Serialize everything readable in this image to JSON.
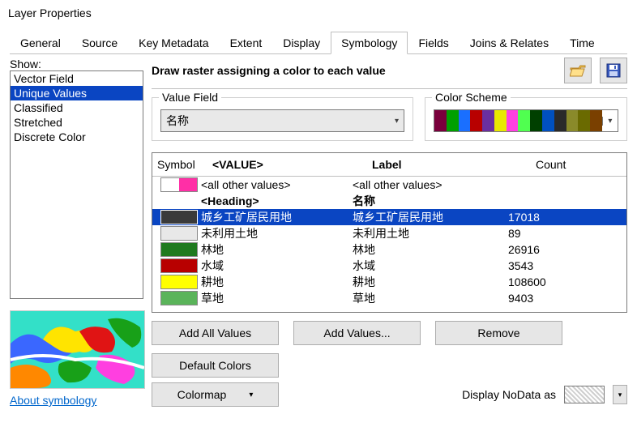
{
  "window": {
    "title": "Layer Properties"
  },
  "tabs": [
    "General",
    "Source",
    "Key Metadata",
    "Extent",
    "Display",
    "Symbology",
    "Fields",
    "Joins & Relates",
    "Time"
  ],
  "left": {
    "show_label": "Show:",
    "items": [
      "Vector Field",
      "Unique Values",
      "Classified",
      "Stretched",
      "Discrete Color"
    ],
    "selected_index": 1,
    "about": "About symbology"
  },
  "right": {
    "draw_label": "Draw raster assigning a color to each value",
    "value_field": {
      "legend": "Value Field",
      "selected": "名称"
    },
    "color_scheme": {
      "legend": "Color Scheme",
      "swatches": [
        "#7a003c",
        "#00a000",
        "#1a6fff",
        "#b80000",
        "#6a2fa0",
        "#e8e800",
        "#ff40e0",
        "#50ff50",
        "#004000",
        "#0050c0",
        "#2a2a2a",
        "#8a8a2a",
        "#6a6a00",
        "#7a4000"
      ]
    },
    "grid": {
      "headers": {
        "symbol": "Symbol",
        "value": "<VALUE>",
        "label": "Label",
        "count": "Count"
      },
      "all_other": {
        "value": "<all other values>",
        "label": "<all other values>",
        "color": "#ff2fa6"
      },
      "heading": {
        "value": "<Heading>",
        "label": "名称"
      },
      "rows": [
        {
          "color": "#3a3a3a",
          "value": "城乡工矿居民用地",
          "label": "城乡工矿居民用地",
          "count": "17018",
          "selected": true
        },
        {
          "color": "#e8e8e8",
          "value": "未利用土地",
          "label": "未利用土地",
          "count": "89"
        },
        {
          "color": "#1f7a1f",
          "value": "林地",
          "label": "林地",
          "count": "26916"
        },
        {
          "color": "#b80000",
          "value": "水域",
          "label": "水域",
          "count": "3543"
        },
        {
          "color": "#ffff00",
          "value": "耕地",
          "label": "耕地",
          "count": "108600"
        },
        {
          "color": "#5ab45a",
          "value": "草地",
          "label": "草地",
          "count": "9403"
        }
      ]
    },
    "buttons": {
      "add_all": "Add All Values",
      "add_values": "Add Values...",
      "remove": "Remove",
      "default_colors": "Default Colors",
      "colormap": "Colormap"
    },
    "nodata_label": "Display NoData as"
  }
}
